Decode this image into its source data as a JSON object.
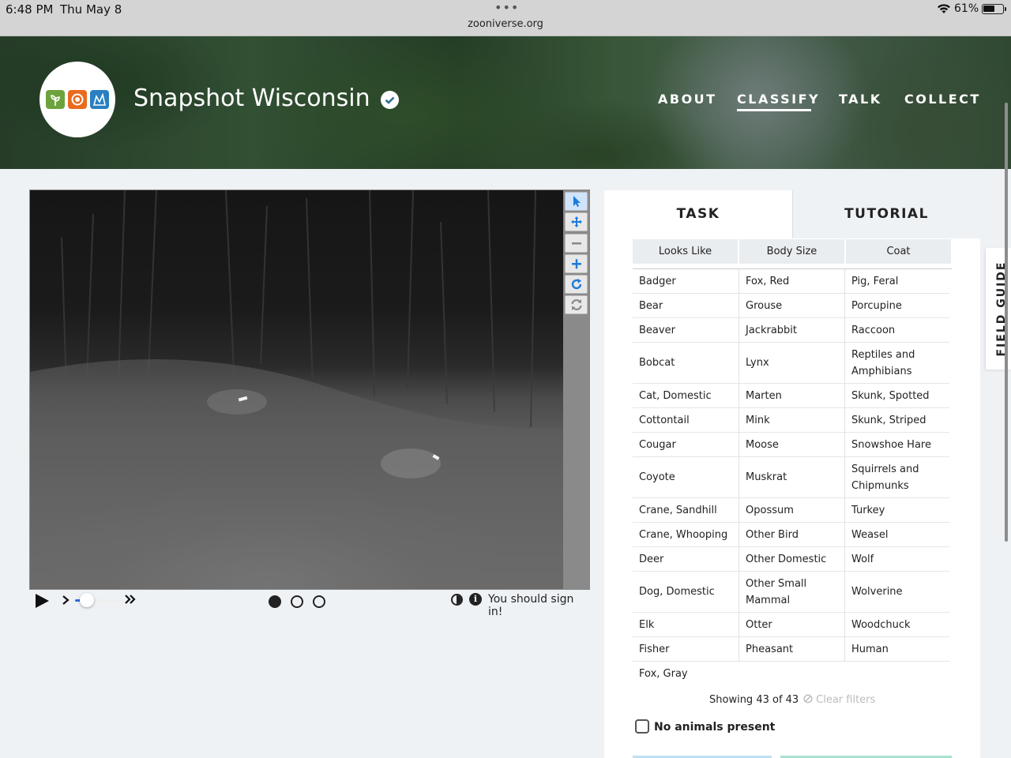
{
  "status_bar": {
    "time": "6:48 PM",
    "date": "Thu May 8",
    "url": "zooniverse.org",
    "battery_text": "61%",
    "battery_level": 0.61
  },
  "header": {
    "project_title": "Snapshot Wisconsin",
    "nav": [
      "ABOUT",
      "CLASSIFY",
      "TALK",
      "COLLECT"
    ],
    "active_nav": "CLASSIFY"
  },
  "viewer": {
    "tools": [
      "pointer-icon",
      "move-icon",
      "zoom-out-icon",
      "zoom-in-icon",
      "rotate-icon",
      "reset-icon"
    ],
    "frames": 3,
    "current_frame": 1,
    "signin_text": "You should sign in!"
  },
  "task": {
    "tabs": [
      "TASK",
      "TUTORIAL"
    ],
    "filters": [
      "Looks Like",
      "Body Size",
      "Coat"
    ],
    "rows": [
      [
        "Badger",
        "Fox, Red",
        "Pig, Feral"
      ],
      [
        "Bear",
        "Grouse",
        "Porcupine"
      ],
      [
        "Beaver",
        "Jackrabbit",
        "Raccoon"
      ],
      [
        "Bobcat",
        "Lynx",
        "Reptiles and Amphibians"
      ],
      [
        "Cat, Domestic",
        "Marten",
        "Skunk, Spotted"
      ],
      [
        "Cottontail",
        "Mink",
        "Skunk, Striped"
      ],
      [
        "Cougar",
        "Moose",
        "Snowshoe Hare"
      ],
      [
        "Coyote",
        "Muskrat",
        "Squirrels and Chipmunks"
      ],
      [
        "Crane, Sandhill",
        "Opossum",
        "Turkey"
      ],
      [
        "Crane, Whooping",
        "Other Bird",
        "Weasel"
      ],
      [
        "Deer",
        "Other Domestic",
        "Wolf"
      ],
      [
        "Dog, Domestic",
        "Other Small Mammal",
        "Wolverine"
      ],
      [
        "Elk",
        "Otter",
        "Woodchuck"
      ],
      [
        "Fisher",
        "Pheasant",
        "Human"
      ],
      [
        "Fox, Gray",
        "",
        ""
      ]
    ],
    "showing_text": "Showing 43 of 43",
    "clear_filters": "Clear filters",
    "no_animals": "No animals present"
  },
  "field_guide": "FIELD GUIDE",
  "colors": {
    "accent_blue": "#2b6de0",
    "logo_green": "#6da33d",
    "logo_orange": "#e96a1e",
    "logo_blue": "#2a7fc1"
  }
}
